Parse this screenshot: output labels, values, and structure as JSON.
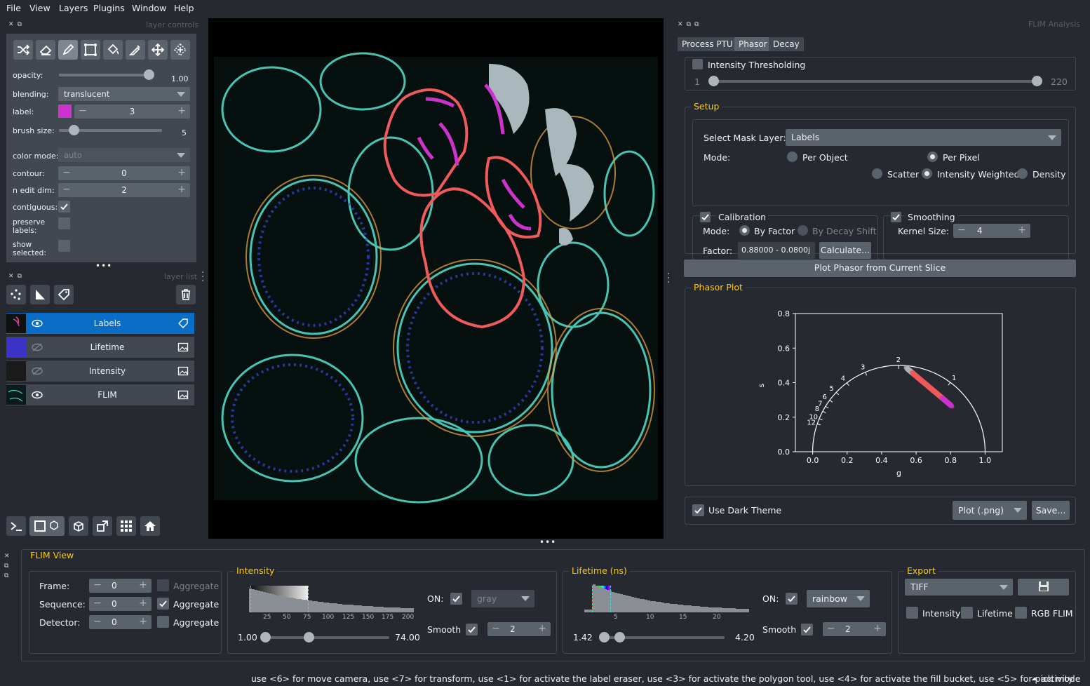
{
  "menu": [
    "File",
    "View",
    "Layers",
    "Plugins",
    "Window",
    "Help"
  ],
  "layer_controls": {
    "title": "layer controls",
    "opacity_label": "opacity:",
    "opacity_value": "1.00",
    "opacity": 1.0,
    "blending_label": "blending:",
    "blending_value": "translucent",
    "label_label": "label:",
    "label_value": "3",
    "label_color": "#cc33cc",
    "brush_label": "brush size:",
    "brush_value": "5",
    "brush_fraction": 0.1,
    "colormode_label": "color mode:",
    "colormode_value": "auto",
    "contour_label": "contour:",
    "contour_value": "0",
    "nedit_label": "n edit dim:",
    "nedit_value": "2",
    "contiguous_label": "contiguous:",
    "preserve_label_1": "preserve",
    "preserve_label_2": "labels:",
    "show_label_1": "show",
    "show_label_2": "selected:"
  },
  "layer_list": {
    "title": "layer list",
    "layers": [
      {
        "name": "Labels",
        "visible": true
      },
      {
        "name": "Lifetime",
        "visible": false
      },
      {
        "name": "Intensity",
        "visible": false
      },
      {
        "name": "FLIM",
        "visible": true
      }
    ]
  },
  "flim_analysis": {
    "title": "FLIM Analysis",
    "tabs": [
      "Process PTU",
      "Phasor",
      "Decay"
    ],
    "active_tab": "Phasor",
    "threshold_label": "Intensity Thresholding",
    "threshold_min": "1",
    "threshold_max": "220",
    "setup_title": "Setup",
    "mask_label": "Select Mask Layer:",
    "mask_value": "Labels",
    "mode_label": "Mode:",
    "per_object": "Per Object",
    "per_pixel": "Per Pixel",
    "scatter": "Scatter",
    "intensity_weighted": "Intensity Weighted",
    "density": "Density",
    "calibration_label": "Calibration",
    "cal_mode_label": "Mode:",
    "by_factor": "By Factor",
    "by_decay": "By Decay Shift",
    "factor_label": "Factor:",
    "factor_value": "0.88000 - 0.0800j",
    "calculate_button": "Calculate...",
    "smoothing_label": "Smoothing",
    "kernel_label": "Kernel Size:",
    "kernel_value": "4",
    "plot_button": "Plot Phasor from Current Slice",
    "phasor_title": "Phasor Plot",
    "dark_theme_label": "Use Dark Theme",
    "plot_format": "Plot (.png)",
    "save_button": "Save..."
  },
  "chart_data": {
    "type": "scatter",
    "xlabel": "g",
    "ylabel": "s",
    "xlim": [
      -0.1,
      1.1
    ],
    "ylim": [
      0.0,
      0.8
    ],
    "xticks": [
      "0.0",
      "0.2",
      "0.4",
      "0.6",
      "0.8",
      "1.0"
    ],
    "yticks": [
      "0.0",
      "0.2",
      "0.4",
      "0.6",
      "0.8"
    ],
    "semicircle_labels": [
      "1",
      "2",
      "3",
      "4",
      "5",
      "6",
      "7",
      "8",
      "10",
      "12"
    ],
    "cluster": {
      "g_start": 0.55,
      "s_start": 0.48,
      "g_end": 0.8,
      "s_end": 0.27
    },
    "colors": {
      "gray": "#aab4bc",
      "red": "#f05a5a",
      "magenta": "#cc33cc"
    }
  },
  "flim_view": {
    "title": "FLIM View",
    "frame_label": "Frame:",
    "frame_value": "0",
    "sequence_label": "Sequence:",
    "sequence_value": "0",
    "detector_label": "Detector:",
    "detector_value": "0",
    "aggregate": "Aggregate",
    "intensity_title": "Intensity",
    "int_ticks": [
      "25",
      "50",
      "75",
      "100",
      "125",
      "150",
      "175",
      "200"
    ],
    "int_min": "1.00",
    "int_max": "74.00",
    "on_label": "ON:",
    "int_cmap": "gray",
    "smooth_label": "Smooth",
    "int_smooth": "2",
    "lifetime_title": "Lifetime (ns)",
    "life_ticks": [
      "5",
      "10",
      "15",
      "20"
    ],
    "life_min": "1.42",
    "life_max": "4.20",
    "life_cmap": "rainbow",
    "life_smooth": "2",
    "export_title": "Export",
    "export_format": "TIFF",
    "export_intensity": "Intensity",
    "export_lifetime": "Lifetime",
    "export_rgb": "RGB FLIM"
  },
  "status": "use <6> for move camera, use <7> for transform, use <1> for activate the label eraser, use <3> for activate the polygon tool, use <4> for activate the fill bucket, use <5> for pick mode",
  "activity": "activity"
}
